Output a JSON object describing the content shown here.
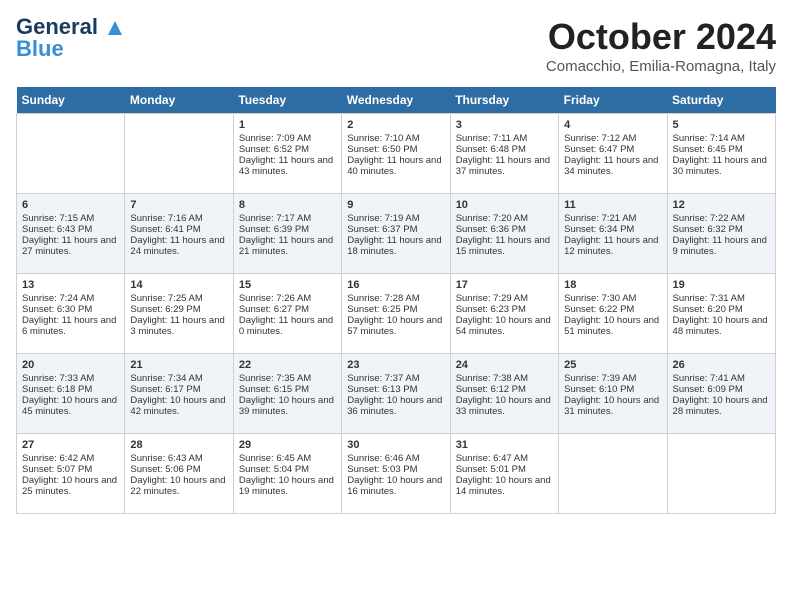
{
  "header": {
    "logo_line1": "General",
    "logo_line2": "Blue",
    "month_title": "October 2024",
    "location": "Comacchio, Emilia-Romagna, Italy"
  },
  "days_of_week": [
    "Sunday",
    "Monday",
    "Tuesday",
    "Wednesday",
    "Thursday",
    "Friday",
    "Saturday"
  ],
  "weeks": [
    [
      {
        "day": "",
        "sunrise": "",
        "sunset": "",
        "daylight": ""
      },
      {
        "day": "",
        "sunrise": "",
        "sunset": "",
        "daylight": ""
      },
      {
        "day": "1",
        "sunrise": "Sunrise: 7:09 AM",
        "sunset": "Sunset: 6:52 PM",
        "daylight": "Daylight: 11 hours and 43 minutes."
      },
      {
        "day": "2",
        "sunrise": "Sunrise: 7:10 AM",
        "sunset": "Sunset: 6:50 PM",
        "daylight": "Daylight: 11 hours and 40 minutes."
      },
      {
        "day": "3",
        "sunrise": "Sunrise: 7:11 AM",
        "sunset": "Sunset: 6:48 PM",
        "daylight": "Daylight: 11 hours and 37 minutes."
      },
      {
        "day": "4",
        "sunrise": "Sunrise: 7:12 AM",
        "sunset": "Sunset: 6:47 PM",
        "daylight": "Daylight: 11 hours and 34 minutes."
      },
      {
        "day": "5",
        "sunrise": "Sunrise: 7:14 AM",
        "sunset": "Sunset: 6:45 PM",
        "daylight": "Daylight: 11 hours and 30 minutes."
      }
    ],
    [
      {
        "day": "6",
        "sunrise": "Sunrise: 7:15 AM",
        "sunset": "Sunset: 6:43 PM",
        "daylight": "Daylight: 11 hours and 27 minutes."
      },
      {
        "day": "7",
        "sunrise": "Sunrise: 7:16 AM",
        "sunset": "Sunset: 6:41 PM",
        "daylight": "Daylight: 11 hours and 24 minutes."
      },
      {
        "day": "8",
        "sunrise": "Sunrise: 7:17 AM",
        "sunset": "Sunset: 6:39 PM",
        "daylight": "Daylight: 11 hours and 21 minutes."
      },
      {
        "day": "9",
        "sunrise": "Sunrise: 7:19 AM",
        "sunset": "Sunset: 6:37 PM",
        "daylight": "Daylight: 11 hours and 18 minutes."
      },
      {
        "day": "10",
        "sunrise": "Sunrise: 7:20 AM",
        "sunset": "Sunset: 6:36 PM",
        "daylight": "Daylight: 11 hours and 15 minutes."
      },
      {
        "day": "11",
        "sunrise": "Sunrise: 7:21 AM",
        "sunset": "Sunset: 6:34 PM",
        "daylight": "Daylight: 11 hours and 12 minutes."
      },
      {
        "day": "12",
        "sunrise": "Sunrise: 7:22 AM",
        "sunset": "Sunset: 6:32 PM",
        "daylight": "Daylight: 11 hours and 9 minutes."
      }
    ],
    [
      {
        "day": "13",
        "sunrise": "Sunrise: 7:24 AM",
        "sunset": "Sunset: 6:30 PM",
        "daylight": "Daylight: 11 hours and 6 minutes."
      },
      {
        "day": "14",
        "sunrise": "Sunrise: 7:25 AM",
        "sunset": "Sunset: 6:29 PM",
        "daylight": "Daylight: 11 hours and 3 minutes."
      },
      {
        "day": "15",
        "sunrise": "Sunrise: 7:26 AM",
        "sunset": "Sunset: 6:27 PM",
        "daylight": "Daylight: 11 hours and 0 minutes."
      },
      {
        "day": "16",
        "sunrise": "Sunrise: 7:28 AM",
        "sunset": "Sunset: 6:25 PM",
        "daylight": "Daylight: 10 hours and 57 minutes."
      },
      {
        "day": "17",
        "sunrise": "Sunrise: 7:29 AM",
        "sunset": "Sunset: 6:23 PM",
        "daylight": "Daylight: 10 hours and 54 minutes."
      },
      {
        "day": "18",
        "sunrise": "Sunrise: 7:30 AM",
        "sunset": "Sunset: 6:22 PM",
        "daylight": "Daylight: 10 hours and 51 minutes."
      },
      {
        "day": "19",
        "sunrise": "Sunrise: 7:31 AM",
        "sunset": "Sunset: 6:20 PM",
        "daylight": "Daylight: 10 hours and 48 minutes."
      }
    ],
    [
      {
        "day": "20",
        "sunrise": "Sunrise: 7:33 AM",
        "sunset": "Sunset: 6:18 PM",
        "daylight": "Daylight: 10 hours and 45 minutes."
      },
      {
        "day": "21",
        "sunrise": "Sunrise: 7:34 AM",
        "sunset": "Sunset: 6:17 PM",
        "daylight": "Daylight: 10 hours and 42 minutes."
      },
      {
        "day": "22",
        "sunrise": "Sunrise: 7:35 AM",
        "sunset": "Sunset: 6:15 PM",
        "daylight": "Daylight: 10 hours and 39 minutes."
      },
      {
        "day": "23",
        "sunrise": "Sunrise: 7:37 AM",
        "sunset": "Sunset: 6:13 PM",
        "daylight": "Daylight: 10 hours and 36 minutes."
      },
      {
        "day": "24",
        "sunrise": "Sunrise: 7:38 AM",
        "sunset": "Sunset: 6:12 PM",
        "daylight": "Daylight: 10 hours and 33 minutes."
      },
      {
        "day": "25",
        "sunrise": "Sunrise: 7:39 AM",
        "sunset": "Sunset: 6:10 PM",
        "daylight": "Daylight: 10 hours and 31 minutes."
      },
      {
        "day": "26",
        "sunrise": "Sunrise: 7:41 AM",
        "sunset": "Sunset: 6:09 PM",
        "daylight": "Daylight: 10 hours and 28 minutes."
      }
    ],
    [
      {
        "day": "27",
        "sunrise": "Sunrise: 6:42 AM",
        "sunset": "Sunset: 5:07 PM",
        "daylight": "Daylight: 10 hours and 25 minutes."
      },
      {
        "day": "28",
        "sunrise": "Sunrise: 6:43 AM",
        "sunset": "Sunset: 5:06 PM",
        "daylight": "Daylight: 10 hours and 22 minutes."
      },
      {
        "day": "29",
        "sunrise": "Sunrise: 6:45 AM",
        "sunset": "Sunset: 5:04 PM",
        "daylight": "Daylight: 10 hours and 19 minutes."
      },
      {
        "day": "30",
        "sunrise": "Sunrise: 6:46 AM",
        "sunset": "Sunset: 5:03 PM",
        "daylight": "Daylight: 10 hours and 16 minutes."
      },
      {
        "day": "31",
        "sunrise": "Sunrise: 6:47 AM",
        "sunset": "Sunset: 5:01 PM",
        "daylight": "Daylight: 10 hours and 14 minutes."
      },
      {
        "day": "",
        "sunrise": "",
        "sunset": "",
        "daylight": ""
      },
      {
        "day": "",
        "sunrise": "",
        "sunset": "",
        "daylight": ""
      }
    ]
  ]
}
